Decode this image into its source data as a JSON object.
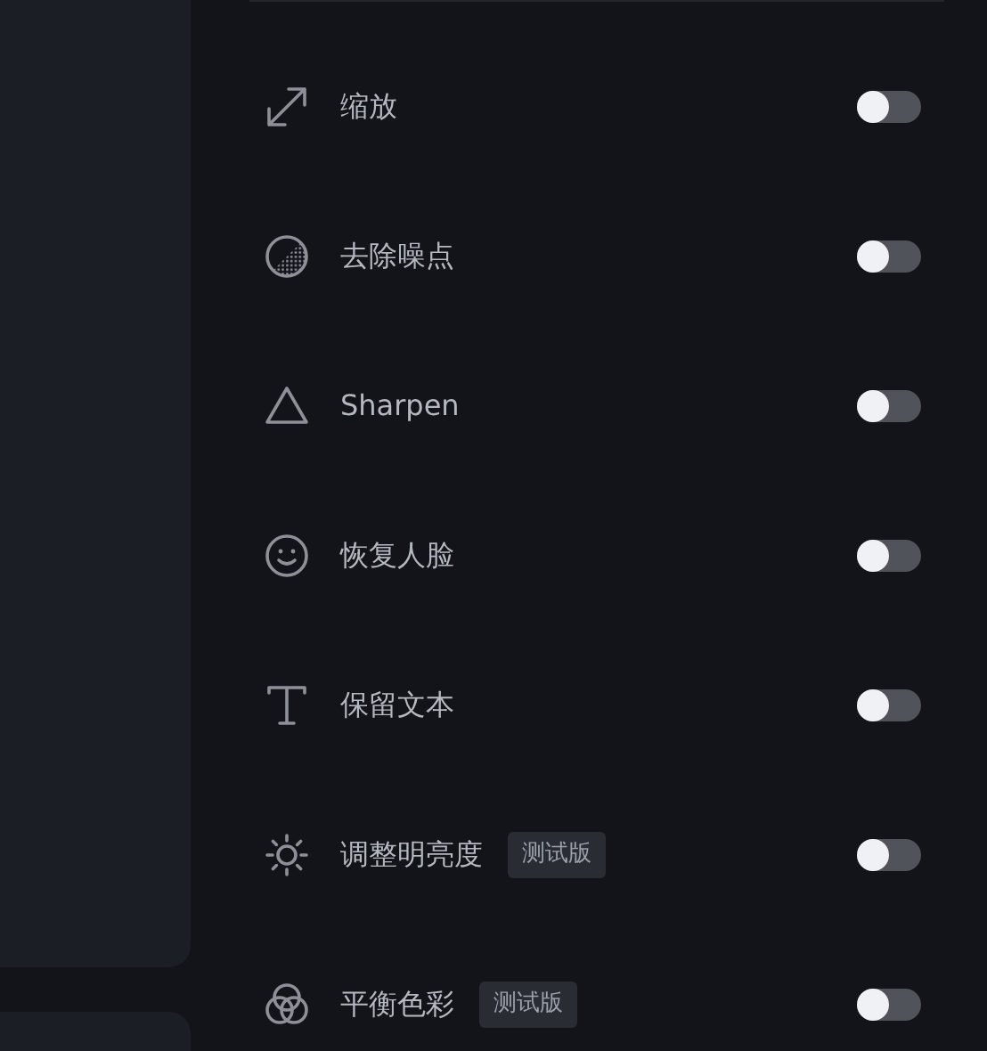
{
  "settings": [
    {
      "label": "缩放",
      "on": false
    },
    {
      "label": "去除噪点",
      "on": false
    },
    {
      "label": "Sharpen",
      "on": false
    },
    {
      "label": "恢复人脸",
      "on": false
    },
    {
      "label": "保留文本",
      "on": false
    },
    {
      "label": "调整明亮度",
      "badge": "测试版",
      "on": false
    },
    {
      "label": "平衡色彩",
      "badge": "测试版",
      "on": false
    }
  ]
}
